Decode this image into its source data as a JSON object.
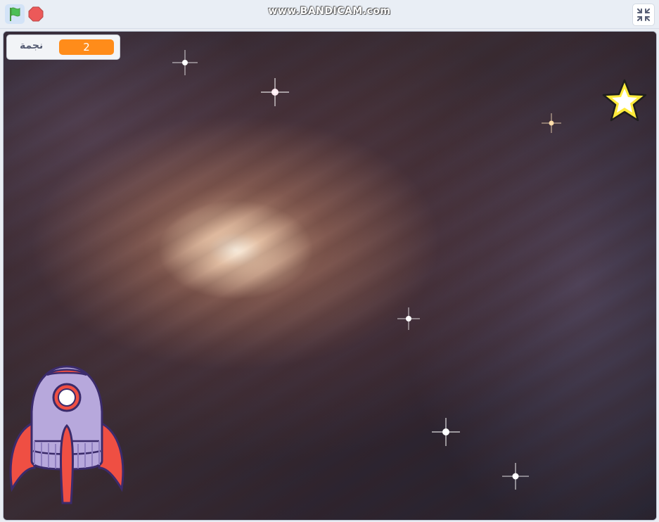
{
  "toolbar": {
    "green_flag_icon": "green-flag-icon",
    "stop_icon": "stop-icon",
    "fullscreen_icon": "exit-fullscreen-icon",
    "watermark": "www.BANDICAM.com"
  },
  "stage": {
    "backdrop": "spiral-galaxy",
    "monitor": {
      "label": "نجمة",
      "value": "2"
    },
    "sprites": {
      "star": "star-sprite",
      "rocket": "rocket-sprite"
    }
  },
  "colors": {
    "flag_green": "#4cbf56",
    "stop_red": "#ec5959",
    "monitor_orange": "#ff8c1a",
    "star_yellow": "#ffeb3b",
    "rocket_purple": "#b7a8dc",
    "rocket_red": "#ef4f43"
  }
}
